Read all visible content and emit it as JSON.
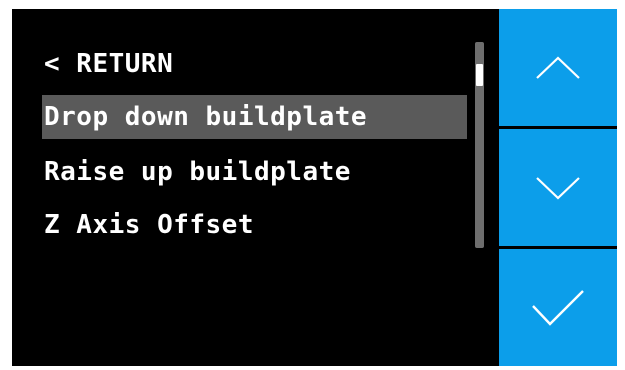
{
  "menu": {
    "items": [
      {
        "label": "< RETURN",
        "selected": false
      },
      {
        "label": "Drop down buildplate",
        "selected": true
      },
      {
        "label": "Raise up buildplate",
        "selected": false
      },
      {
        "label": "Z Axis Offset",
        "selected": false
      }
    ]
  },
  "scrollbar": {
    "position": 0.12
  },
  "side_buttons": [
    {
      "name": "scroll-up-button",
      "icon": "chevron-up-icon"
    },
    {
      "name": "scroll-down-button",
      "icon": "chevron-down-icon"
    },
    {
      "name": "confirm-button",
      "icon": "checkmark-icon"
    }
  ],
  "colors": {
    "background": "#000000",
    "selected_row": "#5a5a5a",
    "button": "#0c9eea",
    "text": "#ffffff"
  }
}
